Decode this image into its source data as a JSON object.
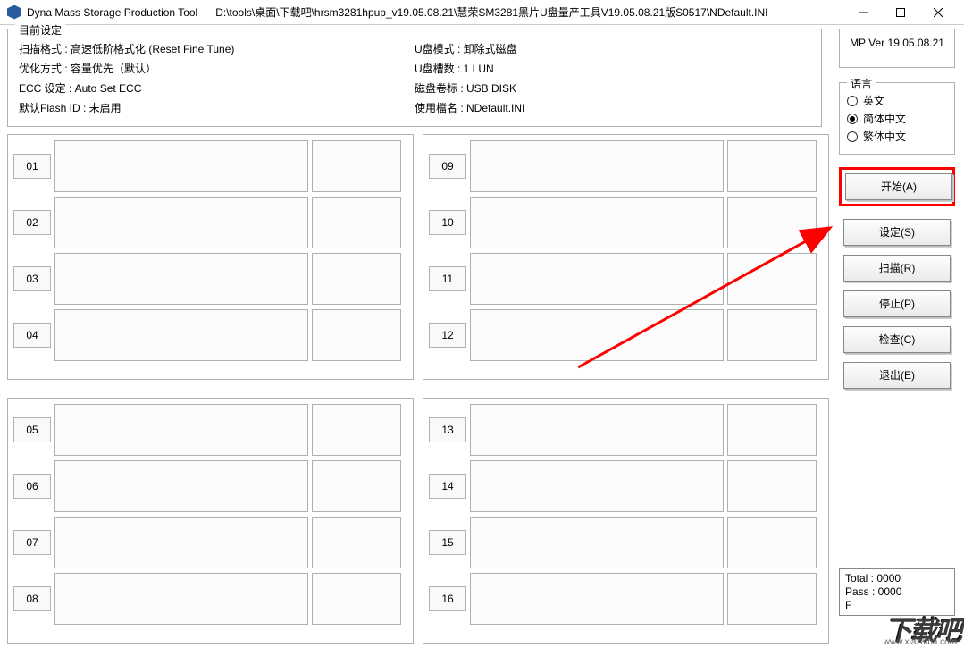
{
  "window": {
    "title": "Dyna Mass Storage Production Tool",
    "path": "D:\\tools\\桌面\\下载吧\\hrsm3281hpup_v19.05.08.21\\慧荣SM3281黑片U盘量产工具V19.05.08.21版S0517\\NDefault.INI"
  },
  "settings": {
    "legend": "目前设定",
    "left": {
      "row1": "扫描格式 : 高速低阶格式化 (Reset Fine Tune)",
      "row2": "优化方式 : 容量优先（默认）",
      "row3": "ECC 设定 : Auto Set ECC",
      "row4": "默认Flash ID : 未启用"
    },
    "right": {
      "row1": "U盘模式 : 卸除式磁盘",
      "row2": "U盘槽数 : 1 LUN",
      "row3": "磁盘卷标 : USB DISK",
      "row4": "使用檔名 : NDefault.INI"
    }
  },
  "slots": {
    "panel1": [
      "01",
      "02",
      "03",
      "04"
    ],
    "panel2": [
      "09",
      "10",
      "11",
      "12"
    ],
    "panel3": [
      "05",
      "06",
      "07",
      "08"
    ],
    "panel4": [
      "13",
      "14",
      "15",
      "16"
    ]
  },
  "rail": {
    "version": "MP Ver 19.05.08.21",
    "lang": {
      "legend": "语言",
      "opt1": "英文",
      "opt2": "简体中文",
      "opt3": "繁体中文",
      "selected": 1
    },
    "buttons": {
      "start": "开始(A)",
      "settings": "设定(S)",
      "scan": "扫描(R)",
      "stop": "停止(P)",
      "check": "检查(C)",
      "exit": "退出(E)"
    }
  },
  "stats": {
    "total": "Total : 0000",
    "pass": "Pass : 0000",
    "fail": "F"
  },
  "watermark": "下载吧",
  "watermark_url": "www.xiazaiba.com"
}
